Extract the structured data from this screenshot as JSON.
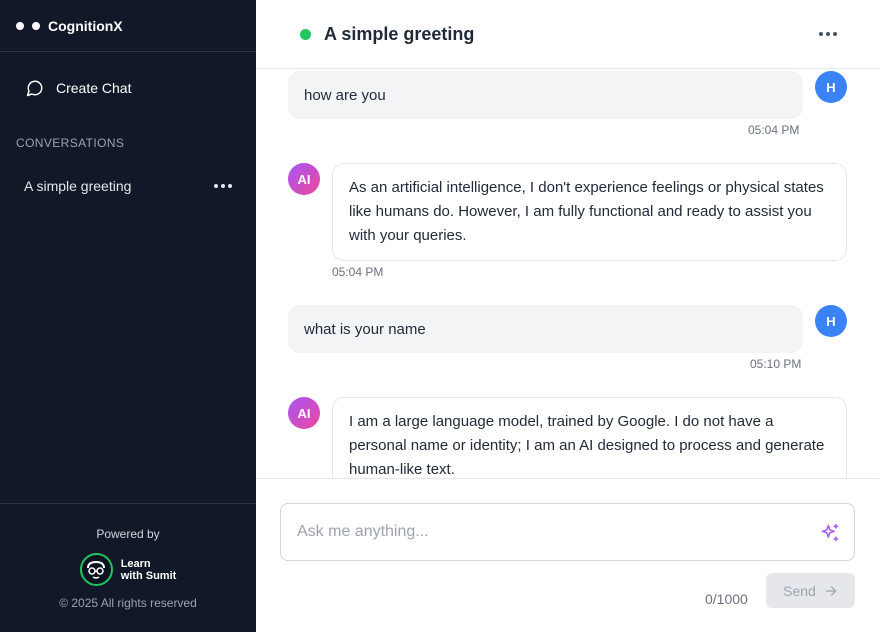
{
  "app": {
    "name": "CognitionX"
  },
  "sidebar": {
    "create_chat_label": "Create Chat",
    "section_title": "CONVERSATIONS",
    "conversations": [
      {
        "label": "A simple greeting"
      }
    ],
    "footer": {
      "powered_by": "Powered by",
      "brand_line1": "Learn",
      "brand_line2": "with Sumit",
      "copyright": "© 2025 All rights reserved"
    }
  },
  "header": {
    "title": "A simple greeting",
    "status_color": "#22c55e"
  },
  "messages": [
    {
      "role": "user",
      "avatar": "H",
      "text": "how are you",
      "time": "05:04 PM"
    },
    {
      "role": "ai",
      "avatar": "AI",
      "text": "As an artificial intelligence, I don't experience feelings or physical states like humans do. However, I am fully functional and ready to assist you with your queries.",
      "time": "05:04 PM"
    },
    {
      "role": "user",
      "avatar": "H",
      "text": "what is your name",
      "time": "05:10 PM"
    },
    {
      "role": "ai",
      "avatar": "AI",
      "text": "I am a large language model, trained by Google. I do not have a personal name or identity; I am an AI designed to process and generate human-like text.",
      "time": ""
    }
  ],
  "composer": {
    "placeholder": "Ask me anything...",
    "char_count": "0/1000",
    "send_label": "Send"
  },
  "colors": {
    "sidebar_bg": "#111827",
    "user_avatar": "#3b82f6",
    "accent": "#a855f7"
  },
  "icons": {
    "create_chat": "chat-bubble-icon",
    "input": "sparkle-icon",
    "send": "arrow-right-icon"
  }
}
